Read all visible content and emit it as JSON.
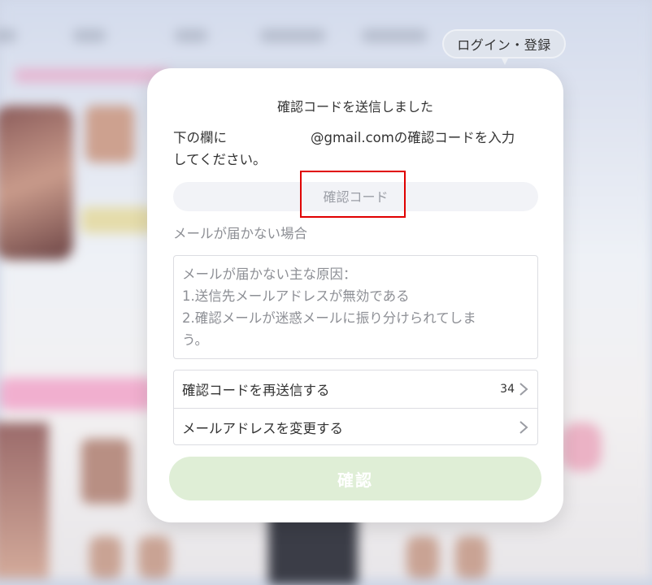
{
  "header": {
    "login_label": "ログイン・登録"
  },
  "dialog": {
    "title": "確認コードを送信しました",
    "instruction_prefix": "下の欄に",
    "instruction_email_suffix": "@gmail.comの確認コードを入力",
    "instruction_line2": "してください。",
    "code_input": {
      "placeholder": "確認コード",
      "value": ""
    },
    "not_received_label": "メールが届かない場合",
    "reasons": [
      "メールが届かない主な原因：",
      "1.送信先メールアドレスが無効である",
      "2.確認メールが迷惑メールに振り分けられてしま",
      "う。"
    ],
    "resend": {
      "label": "確認コードを再送信する",
      "countdown": "34"
    },
    "change_email": {
      "label": "メールアドレスを変更する"
    },
    "confirm_label": "確認"
  },
  "colors": {
    "confirm_button_bg": "#dfeed6",
    "highlight_border": "#e00000",
    "dialog_bg": "#ffffff"
  },
  "icons": {
    "chevron": "chevron-right-icon"
  }
}
